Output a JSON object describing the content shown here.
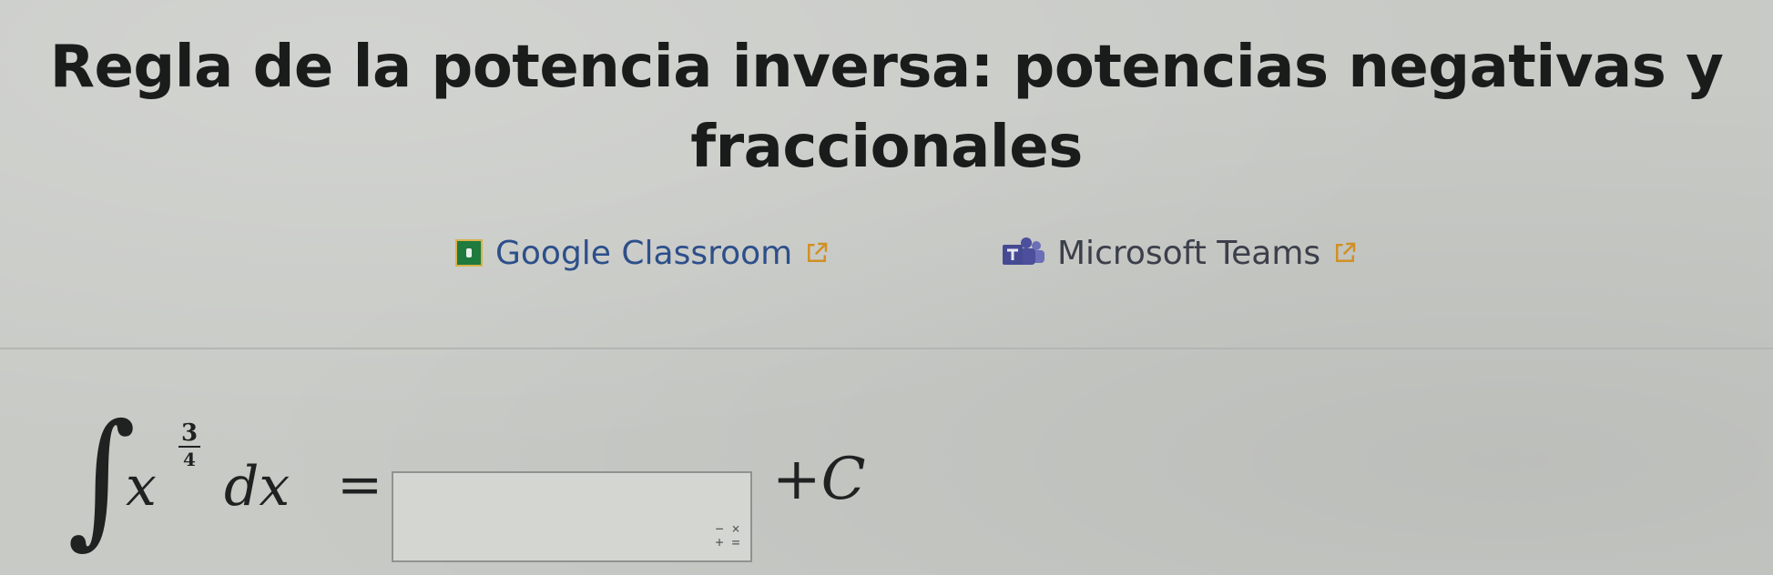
{
  "page": {
    "title": "Regla de la potencia inversa: potencias negativas y fraccionales"
  },
  "share": {
    "classroom_label": "Google Classroom",
    "teams_label": "Microsoft Teams",
    "classroom_icon": "google-classroom-icon",
    "teams_icon": "microsoft-teams-icon",
    "external_link_icon": "external-link-icon"
  },
  "exercise": {
    "integral_symbol": "∫",
    "variable": "x",
    "exponent_numerator": "3",
    "exponent_denominator": "4",
    "differential": "dx",
    "equals": "=",
    "answer_value": "",
    "keypad_icon": "math-keypad-icon",
    "keypad_glyph_top": "− ×",
    "keypad_glyph_bottom": "+ =",
    "constant_plus": "+",
    "constant_c": "C"
  },
  "colors": {
    "background": "#c8cac6",
    "link": "#2d4f8a",
    "classroom_green": "#1f7a3d",
    "teams_purple": "#4b4f9c"
  }
}
